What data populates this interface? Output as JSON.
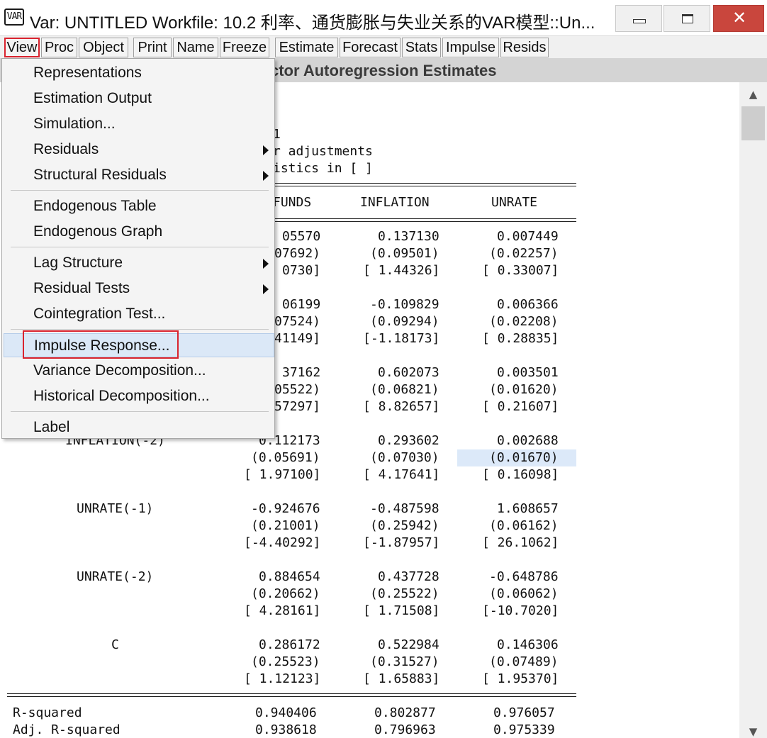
{
  "window": {
    "icon_text": "VAR",
    "title": "Var: UNTITLED   Workfile: 10.2 利率、通货膨胀与失业关系的VAR模型::Un...",
    "controls": {
      "minimize": "minimize-icon",
      "maximize": "maximize-icon",
      "close": "close-icon"
    }
  },
  "toolbar": {
    "items": [
      "View",
      "Proc",
      "Object",
      "Print",
      "Name",
      "Freeze",
      "Estimate",
      "Forecast",
      "Stats",
      "Impulse",
      "Resids"
    ],
    "active": "View"
  },
  "header": {
    "title": "ctor Autoregression Estimates"
  },
  "output": {
    "visible_header_lines": [
      "1",
      "r adjustments",
      "istics in [ ]"
    ],
    "columns": [
      "FUNDS",
      "INFLATION",
      "UNRATE"
    ],
    "rows": [
      {
        "label": "",
        "coef": [
          "05570",
          "0.137130",
          "0.007449"
        ],
        "se": [
          "07692)",
          "(0.09501)",
          "(0.02257)"
        ],
        "t": [
          "0730]",
          "[ 1.44326]",
          "[ 0.33007]"
        ]
      },
      {
        "label": "",
        "coef": [
          "06199",
          "-0.109829",
          "0.006366"
        ],
        "se": [
          "07524)",
          "(0.09294)",
          "(0.02208)"
        ],
        "t": [
          "41149]",
          "[-1.18173]",
          "[ 0.28835]"
        ]
      },
      {
        "label": "",
        "coef": [
          "37162",
          "0.602073",
          "0.003501"
        ],
        "se": [
          "05522)",
          "(0.06821)",
          "(0.01620)"
        ],
        "t": [
          "57297]",
          "[ 8.82657]",
          "[ 0.21607]"
        ]
      },
      {
        "label": "INFLATION(-2)",
        "coef": [
          "0.112173",
          "0.293602",
          "0.002688"
        ],
        "se": [
          "(0.05691)",
          "(0.07030)",
          "(0.01670)"
        ],
        "t": [
          "[ 1.97100]",
          "[ 4.17641]",
          "[ 0.16098]"
        ]
      },
      {
        "label": "UNRATE(-1)",
        "coef": [
          "-0.924676",
          "-0.487598",
          "1.608657"
        ],
        "se": [
          "(0.21001)",
          "(0.25942)",
          "(0.06162)"
        ],
        "t": [
          "[-4.40292]",
          "[-1.87957]",
          "[ 26.1062]"
        ]
      },
      {
        "label": "UNRATE(-2)",
        "coef": [
          "0.884654",
          "0.437728",
          "-0.648786"
        ],
        "se": [
          "(0.20662)",
          "(0.25522)",
          "(0.06062)"
        ],
        "t": [
          "[ 4.28161]",
          "[ 1.71508]",
          "[-10.7020]"
        ]
      },
      {
        "label": "C",
        "coef": [
          "0.286172",
          "0.522984",
          "0.146306"
        ],
        "se": [
          "(0.25523)",
          "(0.31527)",
          "(0.07489)"
        ],
        "t": [
          "[ 1.12123]",
          "[ 1.65883]",
          "[ 1.95370]"
        ]
      }
    ],
    "stats": [
      {
        "label": "R-squared",
        "values": [
          "0.940406",
          "0.802877",
          "0.976057"
        ]
      },
      {
        "label": "Adj. R-squared",
        "values": [
          "0.938618",
          "0.796963",
          "0.975339"
        ]
      }
    ],
    "highlight_color": "#dce9f9"
  },
  "view_menu": {
    "items": [
      {
        "label": "Representations",
        "submenu": false
      },
      {
        "label": "Estimation Output",
        "submenu": false
      },
      {
        "label": "Simulation...",
        "submenu": false
      },
      {
        "label": "Residuals",
        "submenu": true
      },
      {
        "label": "Structural Residuals",
        "submenu": true
      },
      {
        "label": "Endogenous Table",
        "submenu": false
      },
      {
        "label": "Endogenous Graph",
        "submenu": false
      },
      {
        "label": "Lag Structure",
        "submenu": true
      },
      {
        "label": "Residual Tests",
        "submenu": true
      },
      {
        "label": "Cointegration Test...",
        "submenu": false
      },
      {
        "label": "Impulse Response...",
        "submenu": false,
        "highlighted": true
      },
      {
        "label": "Variance Decomposition...",
        "submenu": false
      },
      {
        "label": "Historical Decomposition...",
        "submenu": false
      },
      {
        "label": "Label",
        "submenu": false
      }
    ]
  },
  "colors": {
    "annotation_red": "#d9232e",
    "menu_hover": "#dbe8f7",
    "close_button": "#c9463d"
  }
}
